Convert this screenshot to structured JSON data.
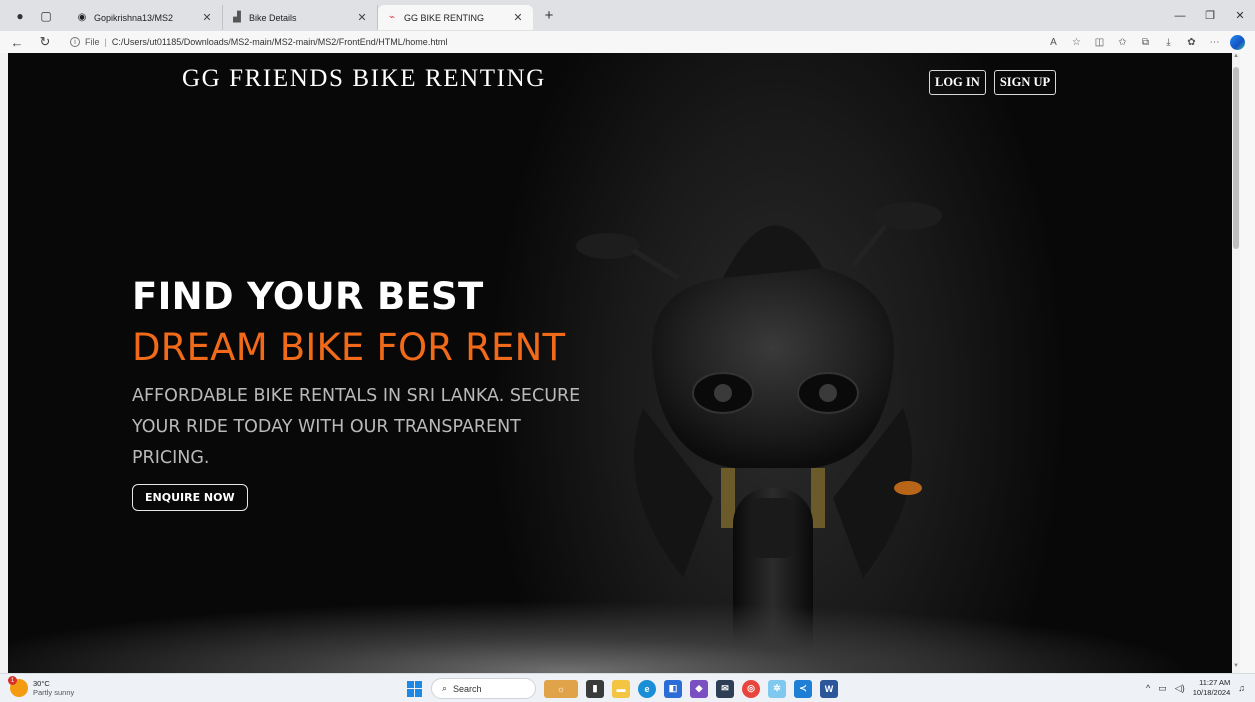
{
  "browser": {
    "tabs": [
      {
        "title": "Gopikrishna13/MS2",
        "icon": "github-icon"
      },
      {
        "title": "Bike Details",
        "icon": "page-icon"
      },
      {
        "title": "GG BIKE RENTING",
        "icon": "bike-favicon",
        "active": true
      }
    ],
    "url_scheme": "File",
    "url": "C:/Users/ut01185/Downloads/MS2-main/MS2-main/MS2/FrontEnd/HTML/home.html"
  },
  "page": {
    "brand": "GG FRIENDS BIKE RENTING",
    "nav": {
      "login": "LOG IN",
      "signup": "SIGN UP"
    },
    "hero": {
      "line1": "FIND YOUR BEST",
      "line2": "DREAM BIKE FOR RENT",
      "subtitle": "AFFORDABLE BIKE RENTALS IN SRI LANKA. SECURE YOUR RIDE TODAY WITH OUR TRANSPARENT PRICING.",
      "cta": "ENQUIRE NOW"
    },
    "colors": {
      "accent": "#f06a1a",
      "background": "#050505",
      "text": "#ffffff"
    }
  },
  "taskbar": {
    "weather": {
      "temp": "30°C",
      "condition": "Partly sunny",
      "badge": "1"
    },
    "search_placeholder": "Search",
    "time": "11:27 AM",
    "date": "10/18/2024"
  }
}
